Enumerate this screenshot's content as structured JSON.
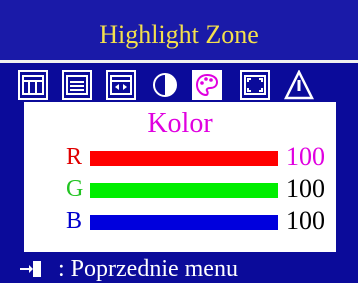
{
  "title": "Highlight Zone",
  "panel": {
    "heading": "Kolor",
    "rows": [
      {
        "label": "R",
        "value": "100",
        "level": 1.0,
        "color": "#ff0000",
        "label_color": "#e00000",
        "value_color": "#e000e0"
      },
      {
        "label": "G",
        "value": "100",
        "level": 1.0,
        "color": "#00ee00",
        "label_color": "#22c422",
        "value_color": "#000000"
      },
      {
        "label": "B",
        "value": "100",
        "level": 1.0,
        "color": "#0000dd",
        "label_color": "#0000cc",
        "value_color": "#000000"
      }
    ]
  },
  "footer": {
    "text": ":  Poprzednie menu"
  },
  "colors": {
    "background": "#0b0b9a",
    "title": "#f4e04d",
    "heading": "#e000e0"
  }
}
